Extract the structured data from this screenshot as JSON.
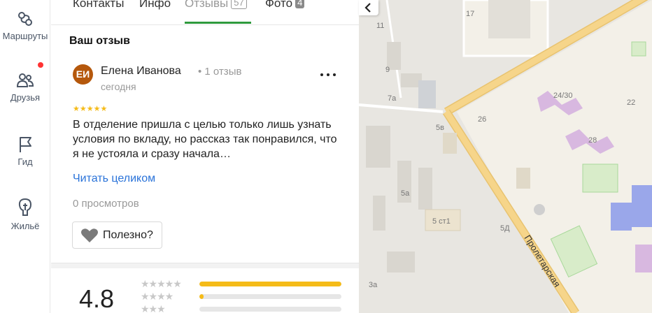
{
  "sidebar": {
    "items": [
      {
        "label": "Маршруты",
        "icon": "routes-icon"
      },
      {
        "label": "Друзья",
        "icon": "friends-icon",
        "notification": true
      },
      {
        "label": "Гид",
        "icon": "flag-icon"
      },
      {
        "label": "Жильё",
        "icon": "housing-icon"
      }
    ]
  },
  "tabs": {
    "contacts": "Контакты",
    "info": "Инфо",
    "reviews": "Отзывы",
    "reviews_count": "57",
    "photos": "Фото",
    "photos_count": "4"
  },
  "review_section": {
    "title": "Ваш отзыв",
    "author": {
      "initials": "ЕИ",
      "name": "Елена Иванова",
      "reviews": "• 1 отзыв",
      "date": "сегодня"
    },
    "stars": "★★★★★",
    "text": "В отделение пришла с целью только лишь узнать условия по вкладу, но рассказ так понравился, что я не устояла и сразу начала…",
    "read_more": "Читать целиком",
    "views": "0 просмотров",
    "useful": "Полезно?"
  },
  "rating": {
    "value": "4.8",
    "distribution": [
      {
        "stars": "★★★★★",
        "fraction": 1.0
      },
      {
        "stars": "★★★★",
        "fraction": 0.03
      },
      {
        "stars": "★★★",
        "fraction": 0.0
      }
    ]
  },
  "map": {
    "street": "Пролетарская",
    "labels": [
      "17",
      "11",
      "9",
      "7а",
      "5в",
      "26",
      "24/30",
      "22",
      "28",
      "5а",
      "5 ст1",
      "5Д",
      "3а"
    ]
  },
  "colors": {
    "accent_green": "#2f9a3d",
    "star": "#f5bb18",
    "link": "#2a73d9",
    "avatar": "#b5580c",
    "road": "#f6d58a"
  }
}
